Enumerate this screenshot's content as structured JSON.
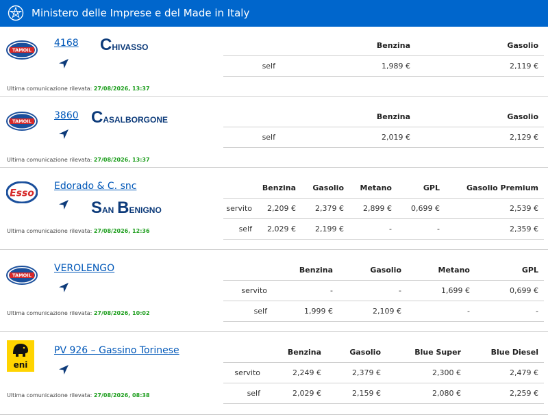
{
  "header": {
    "title": "Ministero delle Imprese e del Made in Italy"
  },
  "stations": [
    {
      "brand": "TAMOIL",
      "brand_icon": "tamoil-logo-icon",
      "link": "4168",
      "city": "Chivasso",
      "last_label": "Ultima comunicazione rilevata: ",
      "last_date": "27/08/2026, 13:37",
      "table": {
        "headers": [
          "",
          "Benzina",
          "Gasolio"
        ],
        "rows": [
          [
            "self",
            "1,989 €",
            "2,119 €"
          ]
        ]
      }
    },
    {
      "brand": "TAMOIL",
      "brand_icon": "tamoil-logo-icon",
      "link": "3860",
      "city": "Casalborgone",
      "last_label": "Ultima comunicazione rilevata: ",
      "last_date": "27/08/2026, 13:37",
      "table": {
        "headers": [
          "",
          "Benzina",
          "Gasolio"
        ],
        "rows": [
          [
            "self",
            "2,019 €",
            "2,129 €"
          ]
        ]
      }
    },
    {
      "brand": "Esso",
      "brand_icon": "esso-logo-icon",
      "link": "Edorado & C. snc",
      "city": "San Benigno",
      "last_label": "Ultima comunicazione rilevata: ",
      "last_date": "27/08/2026, 12:36",
      "table": {
        "headers": [
          "",
          "Benzina",
          "Gasolio",
          "Metano",
          "GPL",
          "Gasolio Premium"
        ],
        "rows": [
          [
            "servito",
            "2,209 €",
            "2,379 €",
            "2,899 €",
            "0,699 €",
            "2,539 €"
          ],
          [
            "self",
            "2,029 €",
            "2,199 €",
            "-",
            "-",
            "2,359 €"
          ]
        ]
      }
    },
    {
      "brand": "TAMOIL",
      "brand_icon": "tamoil-logo-icon",
      "link": "VEROLENGO",
      "city": "",
      "last_label": "Ultima comunicazione rilevata: ",
      "last_date": "27/08/2026, 10:02",
      "table": {
        "headers": [
          "",
          "Benzina",
          "Gasolio",
          "Metano",
          "GPL"
        ],
        "rows": [
          [
            "servito",
            "-",
            "-",
            "1,699 €",
            "0,699 €"
          ],
          [
            "self",
            "1,999 €",
            "2,109 €",
            "-",
            "-"
          ]
        ]
      }
    },
    {
      "brand": "eni",
      "brand_icon": "eni-logo-icon",
      "link": "PV 926 – Gassino Torinese",
      "city": "",
      "last_label": "Ultima comunicazione rilevata: ",
      "last_date": "27/08/2026, 08:38",
      "table": {
        "headers": [
          "",
          "Benzina",
          "Gasolio",
          "Blue Super",
          "Blue Diesel"
        ],
        "rows": [
          [
            "servito",
            "2,249 €",
            "2,379 €",
            "2,300 €",
            "2,479 €"
          ],
          [
            "self",
            "2,029 €",
            "2,159 €",
            "2,080 €",
            "2,259 €"
          ]
        ]
      }
    }
  ]
}
